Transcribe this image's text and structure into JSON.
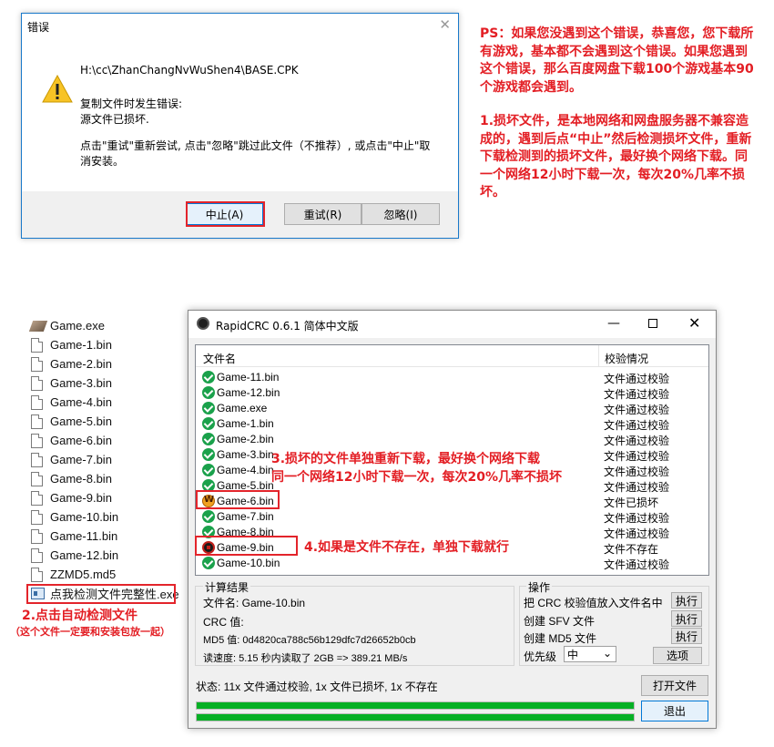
{
  "error_dialog": {
    "title": "错误",
    "close_glyph": "✕",
    "path": "H:\\cc\\ZhanChangNvWuShen4\\BASE.CPK",
    "line1": "复制文件时发生错误:",
    "line2": "源文件已损坏.",
    "line3": "点击\"重试\"重新尝试, 点击\"忽略\"跳过此文件（不推荐）, 或点击\"中止\"取消安装。",
    "buttons": {
      "abort": "中止(A)",
      "retry": "重试(R)",
      "ignore": "忽略(I)"
    }
  },
  "annotations": {
    "ps": "PS：如果您没遇到这个错误，恭喜您，您下载所有游戏，基本都不会遇到这个错误。如果您遇到这个错误，那么百度网盘下载100个游戏基本90个游戏都会遇到。",
    "note1": "1.损坏文件，是本地网络和网盘服务器不兼容造成的，遇到后点“中止”然后检测损坏文件，重新下载检测到的损坏文件，最好换个网络下载。同一个网络12小时下载一次，每次20%几率不损坏。",
    "note2": "2.点击自动检测文件",
    "note2b": "（这个文件一定要和安装包放一起）",
    "note3_line1": "3.损坏的文件单独重新下载，最好换个网络下载",
    "note3_line2": "同一个网络12小时下载一次，每次20%几率不损坏",
    "note4": "4.如果是文件不存在，单独下载就行"
  },
  "explorer": {
    "files": [
      {
        "name": "Game.exe",
        "icon": "exe-icon"
      },
      {
        "name": "Game-1.bin",
        "icon": "file-icon"
      },
      {
        "name": "Game-2.bin",
        "icon": "file-icon"
      },
      {
        "name": "Game-3.bin",
        "icon": "file-icon"
      },
      {
        "name": "Game-4.bin",
        "icon": "file-icon"
      },
      {
        "name": "Game-5.bin",
        "icon": "file-icon"
      },
      {
        "name": "Game-6.bin",
        "icon": "file-icon"
      },
      {
        "name": "Game-7.bin",
        "icon": "file-icon"
      },
      {
        "name": "Game-8.bin",
        "icon": "file-icon"
      },
      {
        "name": "Game-9.bin",
        "icon": "file-icon"
      },
      {
        "name": "Game-10.bin",
        "icon": "file-icon"
      },
      {
        "name": "Game-11.bin",
        "icon": "file-icon"
      },
      {
        "name": "Game-12.bin",
        "icon": "file-icon"
      },
      {
        "name": "ZZMD5.md5",
        "icon": "file-icon"
      },
      {
        "name": "点我检测文件完整性.exe",
        "icon": "app-icon"
      }
    ]
  },
  "rapidcrc": {
    "title": "RapidCRC 0.6.1 简体中文版",
    "min_glyph": "—",
    "close_glyph": "✕",
    "col_name": "文件名",
    "col_status": "校验情况",
    "rows": [
      {
        "name": "Game-11.bin",
        "status": "文件通过校验",
        "state": "ok"
      },
      {
        "name": "Game-12.bin",
        "status": "文件通过校验",
        "state": "ok"
      },
      {
        "name": "Game.exe",
        "status": "文件通过校验",
        "state": "ok"
      },
      {
        "name": "Game-1.bin",
        "status": "文件通过校验",
        "state": "ok"
      },
      {
        "name": "Game-2.bin",
        "status": "文件通过校验",
        "state": "ok"
      },
      {
        "name": "Game-3.bin",
        "status": "文件通过校验",
        "state": "ok"
      },
      {
        "name": "Game-4.bin",
        "status": "文件通过校验",
        "state": "ok"
      },
      {
        "name": "Game-5.bin",
        "status": "文件通过校验",
        "state": "ok"
      },
      {
        "name": "Game-6.bin",
        "status": "文件已损坏",
        "state": "bad"
      },
      {
        "name": "Game-7.bin",
        "status": "文件通过校验",
        "state": "ok"
      },
      {
        "name": "Game-8.bin",
        "status": "文件通过校验",
        "state": "ok"
      },
      {
        "name": "Game-9.bin",
        "status": "文件不存在",
        "state": "missing"
      },
      {
        "name": "Game-10.bin",
        "status": "文件通过校验",
        "state": "ok"
      }
    ],
    "results": {
      "group_title": "计算结果",
      "filename": "文件名: Game-10.bin",
      "crc": "CRC 值:",
      "md5": "MD5 值: 0d4820ca788c56b129dfc7d26652b0cb",
      "speed": "读速度: 5.15 秒内读取了 2GB => 389.21 MB/s"
    },
    "ops": {
      "group_title": "操作",
      "op1": "把 CRC 校验值放入文件名中",
      "op2": "创建 SFV 文件",
      "op3": "创建 MD5 文件",
      "exec": "执行",
      "priority_label": "优先级",
      "priority_value": "中",
      "options_btn": "选项"
    },
    "status": "状态:  11x 文件通过校验, 1x 文件已损坏, 1x 不存在",
    "open_btn": "打开文件",
    "exit_btn": "退出",
    "progress": 1.0
  }
}
